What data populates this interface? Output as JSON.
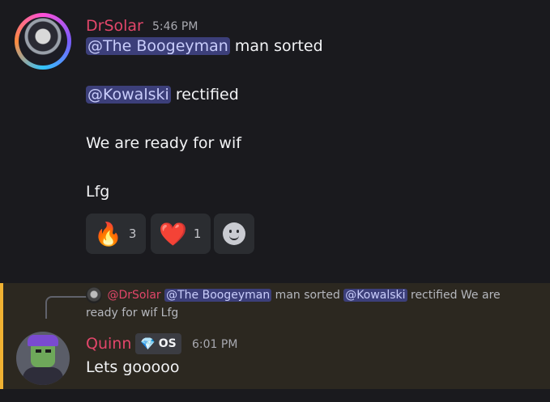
{
  "message1": {
    "author": "DrSolar",
    "time": "5:46 PM",
    "lines": [
      {
        "mention": "@The Boogeyman",
        "text": " man sorted"
      },
      {
        "mention": "@Kowalski",
        "text": " rectified"
      },
      {
        "text": "We are ready for wif"
      },
      {
        "text": "Lfg"
      }
    ],
    "reactions": [
      {
        "emoji": "🔥",
        "count": "3"
      },
      {
        "emoji": "❤️",
        "count": "1"
      }
    ],
    "add_reaction_icon": "smile-icon"
  },
  "message2": {
    "reply": {
      "author": "@DrSolar",
      "mention1": "@The Boogeyman",
      "text1": " man sorted ",
      "mention2": "@Kowalski",
      "text2": " rectified  We are ready for wif  Lfg"
    },
    "author": "Quinn",
    "badge": {
      "icon": "💎",
      "label": "OS"
    },
    "time": "6:01 PM",
    "text": "Lets gooooo",
    "accent_color": "#f0b232"
  }
}
